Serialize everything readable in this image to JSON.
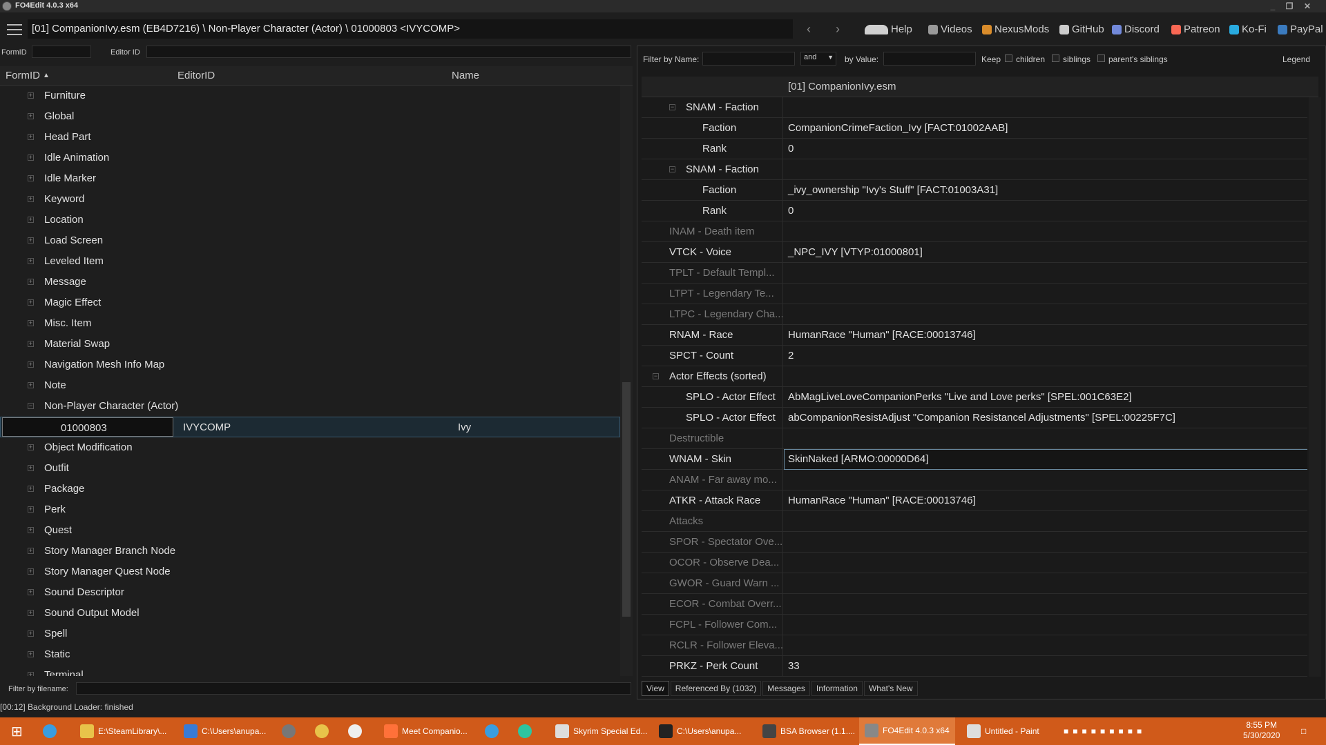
{
  "window": {
    "title": "FO4Edit 4.0.3 x64"
  },
  "path": "[01] CompanionIvy.esm (EB4D7216) \\ Non-Player Character (Actor) \\ 01000803 <IVYCOMP>",
  "top_links": [
    {
      "label": "Help",
      "icon": "book-icon",
      "color": "#d0d0d0"
    },
    {
      "label": "Videos",
      "icon": "video-icon",
      "color": "#999"
    },
    {
      "label": "NexusMods",
      "icon": "nexus-icon",
      "color": "#d98c2b"
    },
    {
      "label": "GitHub",
      "icon": "github-icon",
      "color": "#ccc"
    },
    {
      "label": "Discord",
      "icon": "discord-icon",
      "color": "#7289da"
    },
    {
      "label": "Patreon",
      "icon": "patreon-icon",
      "color": "#f96854"
    },
    {
      "label": "Ko-Fi",
      "icon": "kofi-icon",
      "color": "#29abe0"
    },
    {
      "label": "PayPal",
      "icon": "paypal-icon",
      "color": "#3b7bbf"
    }
  ],
  "left_filter": {
    "formid_label": "FormID",
    "editorid_label": "Editor ID",
    "formid_value": "",
    "editorid_value": ""
  },
  "left_columns": {
    "formid": "FormID",
    "editorid": "EditorID",
    "name": "Name"
  },
  "tree": [
    {
      "label": "Furniture",
      "exp": "+"
    },
    {
      "label": "Global",
      "exp": "+"
    },
    {
      "label": "Head Part",
      "exp": "+"
    },
    {
      "label": "Idle Animation",
      "exp": "+"
    },
    {
      "label": "Idle Marker",
      "exp": "+"
    },
    {
      "label": "Keyword",
      "exp": "+"
    },
    {
      "label": "Location",
      "exp": "+"
    },
    {
      "label": "Load Screen",
      "exp": "+"
    },
    {
      "label": "Leveled Item",
      "exp": "+"
    },
    {
      "label": "Message",
      "exp": "+"
    },
    {
      "label": "Magic Effect",
      "exp": "+"
    },
    {
      "label": "Misc. Item",
      "exp": "+"
    },
    {
      "label": "Material Swap",
      "exp": "+"
    },
    {
      "label": "Navigation Mesh Info Map",
      "exp": "+"
    },
    {
      "label": "Note",
      "exp": "+"
    },
    {
      "label": "Non-Player Character (Actor)",
      "exp": "−"
    }
  ],
  "selected_record": {
    "formid": "01000803",
    "editorid": "IVYCOMP",
    "name": "Ivy"
  },
  "tree_after": [
    {
      "label": "Object Modification",
      "exp": "+"
    },
    {
      "label": "Outfit",
      "exp": "+"
    },
    {
      "label": "Package",
      "exp": "+"
    },
    {
      "label": "Perk",
      "exp": "+"
    },
    {
      "label": "Quest",
      "exp": "+"
    },
    {
      "label": "Story Manager Branch Node",
      "exp": "+"
    },
    {
      "label": "Story Manager Quest Node",
      "exp": "+"
    },
    {
      "label": "Sound Descriptor",
      "exp": "+"
    },
    {
      "label": "Sound Output Model",
      "exp": "+"
    },
    {
      "label": "Spell",
      "exp": "+"
    },
    {
      "label": "Static",
      "exp": "+"
    },
    {
      "label": "Terminal",
      "exp": "+"
    }
  ],
  "filename_filter_label": "Filter by filename:",
  "status": "[00:12] Background Loader: finished",
  "right_filter": {
    "by_name": "Filter by Name:",
    "and": "and",
    "by_value": "by Value:",
    "keep": "Keep",
    "children": "children",
    "siblings": "siblings",
    "parents_siblings": "parent's siblings",
    "legend": "Legend"
  },
  "right_header": "[01] CompanionIvy.esm",
  "rows": [
    {
      "label": "SNAM - Faction",
      "value": "",
      "indent": 1,
      "exp": "−",
      "dim": false
    },
    {
      "label": "Faction",
      "value": "CompanionCrimeFaction_Ivy [FACT:01002AAB]",
      "indent": 2,
      "dim": false
    },
    {
      "label": "Rank",
      "value": "0",
      "indent": 2,
      "dim": false
    },
    {
      "label": "SNAM - Faction",
      "value": "",
      "indent": 1,
      "exp": "−",
      "dim": false
    },
    {
      "label": "Faction",
      "value": "_ivy_ownership \"Ivy's Stuff\" [FACT:01003A31]",
      "indent": 2,
      "dim": false
    },
    {
      "label": "Rank",
      "value": "0",
      "indent": 2,
      "dim": false
    },
    {
      "label": "INAM - Death item",
      "value": "",
      "indent": 0,
      "dim": true
    },
    {
      "label": "VTCK - Voice",
      "value": "_NPC_IVY [VTYP:01000801]",
      "indent": 0,
      "dim": false
    },
    {
      "label": "TPLT - Default Templ...",
      "value": "",
      "indent": 0,
      "dim": true
    },
    {
      "label": "LTPT - Legendary Te...",
      "value": "",
      "indent": 0,
      "dim": true
    },
    {
      "label": "LTPC - Legendary Cha...",
      "value": "",
      "indent": 0,
      "dim": true
    },
    {
      "label": "RNAM - Race",
      "value": "HumanRace \"Human\" [RACE:00013746]",
      "indent": 0,
      "dim": false
    },
    {
      "label": "SPCT - Count",
      "value": "2",
      "indent": 0,
      "dim": false
    },
    {
      "label": "Actor Effects (sorted)",
      "value": "",
      "indent": 0,
      "exp": "−",
      "dim": false
    },
    {
      "label": "SPLO - Actor Effect",
      "value": "AbMagLiveLoveCompanionPerks \"Live and Love perks\" [SPEL:001C63E2]",
      "indent": 1,
      "dim": false
    },
    {
      "label": "SPLO - Actor Effect",
      "value": "abCompanionResistAdjust \"Companion Resistancel Adjustments\" [SPEL:00225F7C]",
      "indent": 1,
      "dim": false
    },
    {
      "label": "Destructible",
      "value": "",
      "indent": 0,
      "dim": true
    },
    {
      "label": "WNAM - Skin",
      "value": "SkinNaked [ARMO:00000D64]",
      "indent": 0,
      "dim": false,
      "highlight": true
    },
    {
      "label": "ANAM - Far away mo...",
      "value": "",
      "indent": 0,
      "dim": true
    },
    {
      "label": "ATKR - Attack Race",
      "value": "HumanRace \"Human\" [RACE:00013746]",
      "indent": 0,
      "dim": false
    },
    {
      "label": "Attacks",
      "value": "",
      "indent": 0,
      "dim": true
    },
    {
      "label": "SPOR - Spectator Ove...",
      "value": "",
      "indent": 0,
      "dim": true
    },
    {
      "label": "OCOR - Observe Dea...",
      "value": "",
      "indent": 0,
      "dim": true
    },
    {
      "label": "GWOR - Guard Warn ...",
      "value": "",
      "indent": 0,
      "dim": true
    },
    {
      "label": "ECOR - Combat Overr...",
      "value": "",
      "indent": 0,
      "dim": true
    },
    {
      "label": "FCPL - Follower Com...",
      "value": "",
      "indent": 0,
      "dim": true
    },
    {
      "label": "RCLR - Follower Eleva...",
      "value": "",
      "indent": 0,
      "dim": true
    },
    {
      "label": "PRKZ - Perk Count",
      "value": "33",
      "indent": 0,
      "dim": false
    }
  ],
  "tabs": [
    {
      "label": "View",
      "active": true
    },
    {
      "label": "Referenced By (1032)",
      "active": false
    },
    {
      "label": "Messages",
      "active": false
    },
    {
      "label": "Information",
      "active": false
    },
    {
      "label": "What's New",
      "active": false
    }
  ],
  "taskbar": [
    {
      "label": "E:\\SteamLibrary\\...",
      "icon": "folder-icon",
      "color": "#e8c34a"
    },
    {
      "label": "C:\\Users\\anupa...",
      "icon": "download-icon",
      "color": "#3a7bd5"
    },
    {
      "label": "Meet Companio...",
      "icon": "firefox-icon",
      "color": "#ff7139"
    },
    {
      "label": "Skyrim Special Ed...",
      "icon": "window-icon",
      "color": "#dddddd"
    },
    {
      "label": "C:\\Users\\anupa...",
      "icon": "7zip-icon",
      "color": "#222222"
    },
    {
      "label": "BSA Browser (1.1....",
      "icon": "bsa-icon",
      "color": "#444444"
    },
    {
      "label": "FO4Edit 4.0.3 x64",
      "icon": "fo4edit-icon",
      "color": "#888888"
    },
    {
      "label": "Untitled - Paint",
      "icon": "paint-icon",
      "color": "#dddddd"
    }
  ],
  "clock": {
    "time": "8:55 PM",
    "date": "5/30/2020"
  }
}
